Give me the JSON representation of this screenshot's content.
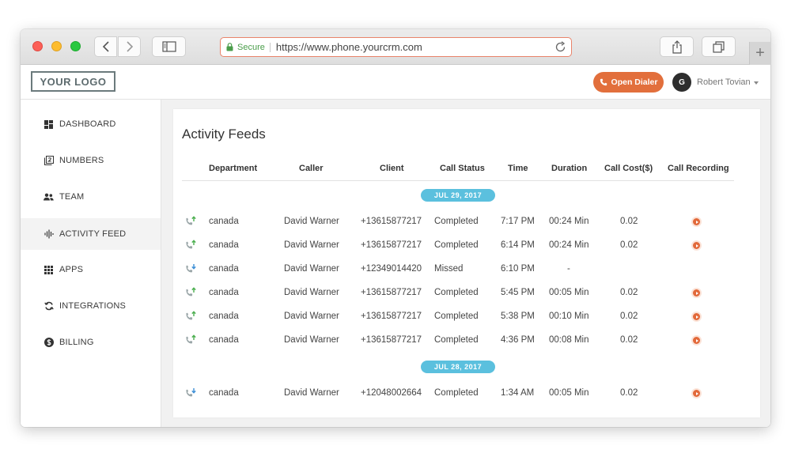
{
  "browser": {
    "secure_label": "Secure",
    "url": "https://www.phone.yourcrm.com"
  },
  "header": {
    "logo": "YOUR LOGO",
    "dialer_label": "Open Dialer",
    "avatar_initial": "G",
    "username": "Robert Tovian"
  },
  "sidebar": {
    "items": [
      {
        "label": "DASHBOARD",
        "icon": "dashboard-icon"
      },
      {
        "label": "NUMBERS",
        "icon": "numbers-icon"
      },
      {
        "label": "TEAM",
        "icon": "team-icon"
      },
      {
        "label": "ACTIVITY FEED",
        "icon": "activity-icon",
        "active": true
      },
      {
        "label": "APPS",
        "icon": "apps-grid-icon"
      },
      {
        "label": "INTEGRATIONS",
        "icon": "sync-icon"
      },
      {
        "label": "BILLING",
        "icon": "dollar-icon"
      }
    ]
  },
  "feed": {
    "title": "Activity Feeds",
    "columns": [
      "Department",
      "Caller",
      "Client",
      "Call Status",
      "Time",
      "Duration",
      "Call Cost($)",
      "Call Recording"
    ],
    "groups": [
      {
        "date": "JUL 29, 2017",
        "rows": [
          {
            "direction": "outgoing",
            "department": "canada",
            "caller": "David Warner",
            "client": "+13615877217",
            "status": "Completed",
            "time": "7:17 PM",
            "duration": "00:24 Min",
            "cost": "0.02",
            "recording": true
          },
          {
            "direction": "outgoing",
            "department": "canada",
            "caller": "David Warner",
            "client": "+13615877217",
            "status": "Completed",
            "time": "6:14 PM",
            "duration": "00:24 Min",
            "cost": "0.02",
            "recording": true
          },
          {
            "direction": "incoming",
            "department": "canada",
            "caller": "David Warner",
            "client": "+12349014420",
            "status": "Missed",
            "time": "6:10 PM",
            "duration": "-",
            "cost": "",
            "recording": false
          },
          {
            "direction": "outgoing",
            "department": "canada",
            "caller": "David Warner",
            "client": "+13615877217",
            "status": "Completed",
            "time": "5:45 PM",
            "duration": "00:05 Min",
            "cost": "0.02",
            "recording": true
          },
          {
            "direction": "outgoing",
            "department": "canada",
            "caller": "David Warner",
            "client": "+13615877217",
            "status": "Completed",
            "time": "5:38 PM",
            "duration": "00:10 Min",
            "cost": "0.02",
            "recording": true
          },
          {
            "direction": "outgoing",
            "department": "canada",
            "caller": "David Warner",
            "client": "+13615877217",
            "status": "Completed",
            "time": "4:36 PM",
            "duration": "00:08 Min",
            "cost": "0.02",
            "recording": true
          }
        ]
      },
      {
        "date": "JUL 28, 2017",
        "rows": [
          {
            "direction": "incoming",
            "department": "canada",
            "caller": "David Warner",
            "client": "+12048002664",
            "status": "Completed",
            "time": "1:34 AM",
            "duration": "00:05 Min",
            "cost": "0.02",
            "recording": true
          }
        ]
      }
    ]
  },
  "colors": {
    "accent": "#e26f3c",
    "pill": "#5bc0de",
    "call_icon_green": "#4caf50",
    "call_icon_blue": "#3d8fd6"
  }
}
